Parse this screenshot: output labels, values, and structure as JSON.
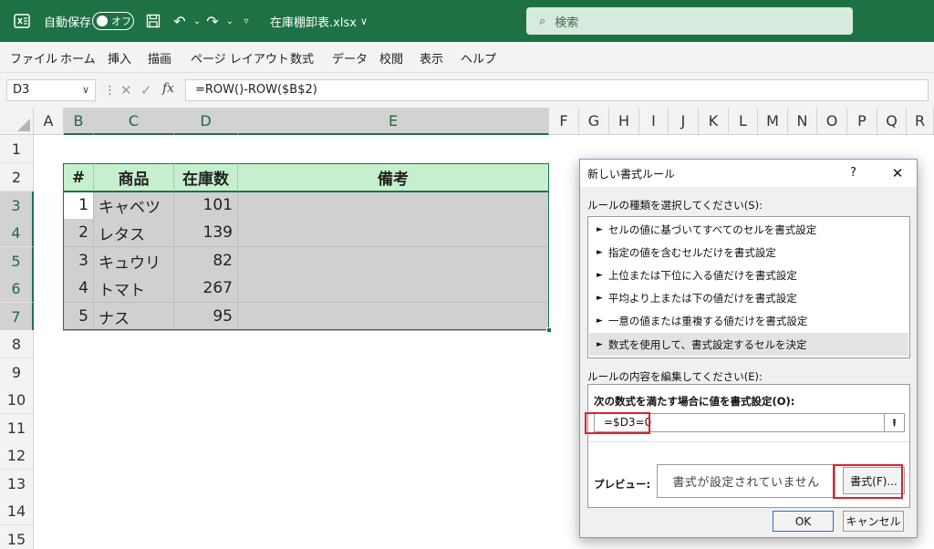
{
  "titlebar": {
    "autosave_label": "自動保存",
    "toggle_text": "オフ",
    "filename": "在庫棚卸表.xlsx",
    "filename_chevron": "∨",
    "search_placeholder": "検索",
    "accent_color": "#1e7145"
  },
  "ribbon": {
    "tabs": [
      "ファイル",
      "ホーム",
      "挿入",
      "描画",
      "ページ レイアウト",
      "数式",
      "データ",
      "校閲",
      "表示",
      "ヘルプ"
    ]
  },
  "formula_bar": {
    "name_box": "D3",
    "fx_label": "fx",
    "formula": "=ROW()-ROW($B$2)"
  },
  "grid": {
    "columns": [
      "A",
      "B",
      "C",
      "D",
      "E",
      "F",
      "G",
      "H",
      "I",
      "J",
      "K",
      "L",
      "M",
      "N",
      "O",
      "P",
      "Q",
      "R"
    ],
    "rows": [
      "1",
      "2",
      "3",
      "4",
      "5",
      "6",
      "7",
      "8",
      "9",
      "10",
      "11",
      "12",
      "13",
      "14",
      "15"
    ],
    "table": {
      "headers": [
        "#",
        "商品",
        "在庫数",
        "備考"
      ],
      "rows": [
        {
          "no": "1",
          "item": "キャベツ",
          "qty": "101",
          "note": ""
        },
        {
          "no": "2",
          "item": "レタス",
          "qty": "139",
          "note": ""
        },
        {
          "no": "3",
          "item": "キュウリ",
          "qty": "82",
          "note": ""
        },
        {
          "no": "4",
          "item": "トマト",
          "qty": "267",
          "note": ""
        },
        {
          "no": "5",
          "item": "ナス",
          "qty": "95",
          "note": ""
        }
      ]
    }
  },
  "dialog": {
    "title": "新しい書式ルール",
    "help": "?",
    "close": "✕",
    "rule_type_label": "ルールの種類を選択してください(S):",
    "rule_types": [
      "セルの値に基づいてすべてのセルを書式設定",
      "指定の値を含むセルだけを書式設定",
      "上位または下位に入る値だけを書式設定",
      "平均より上または下の値だけを書式設定",
      "一意の値または重複する値だけを書式設定",
      "数式を使用して、書式設定するセルを決定"
    ],
    "edit_label": "ルールの内容を編集してください(E):",
    "formula_label": "次の数式を満たす場合に値を書式設定(O):",
    "formula_value": "=$D3=0",
    "preview_label": "プレビュー:",
    "preview_text": "書式が設定されていません",
    "format_button": "書式(F)...",
    "ok_button": "OK",
    "cancel_button": "キャンセル",
    "highlight_color": "#e0202b"
  }
}
